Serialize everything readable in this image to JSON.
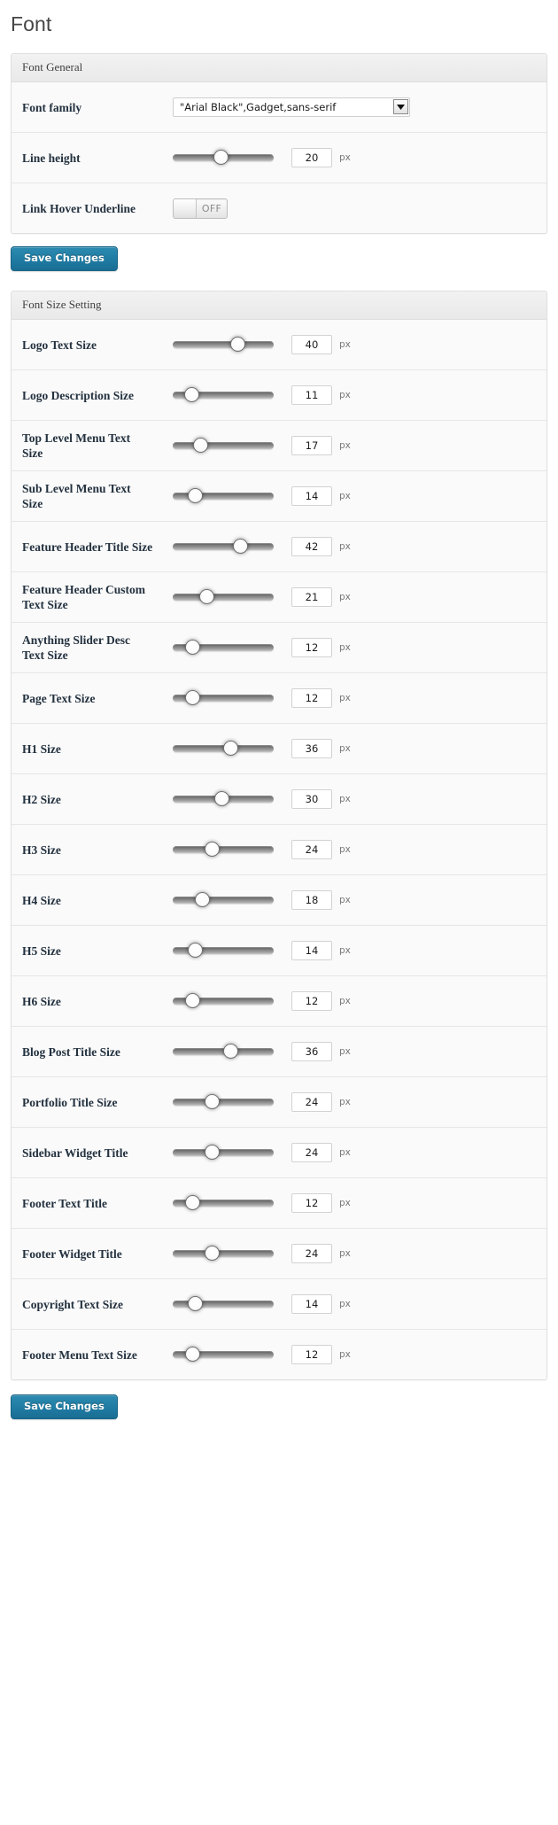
{
  "page": {
    "title": "Font"
  },
  "general_panel": {
    "header": "Font General",
    "rows": [
      {
        "label": "Font family",
        "control": "select",
        "value": "\"Arial Black\",Gadget,sans-serif",
        "icon": "chevron-down-icon"
      },
      {
        "label": "Line height",
        "control": "slider",
        "value": "20",
        "unit": "px",
        "handle_pct": 47
      },
      {
        "label": "Link Hover Underline",
        "control": "toggle",
        "state": "OFF"
      }
    ],
    "save_label": "Save Changes"
  },
  "size_panel": {
    "header": "Font Size Setting",
    "unit": "px",
    "rows": [
      {
        "label": "Logo Text Size",
        "value": "40",
        "handle_pct": 64
      },
      {
        "label": "Logo Description Size",
        "value": "11",
        "handle_pct": 18
      },
      {
        "label": "Top Level Menu Text Size",
        "value": "17",
        "handle_pct": 27
      },
      {
        "label": "Sub Level Menu Text Size",
        "value": "14",
        "handle_pct": 22
      },
      {
        "label": "Feature Header Title Size",
        "value": "42",
        "handle_pct": 67
      },
      {
        "label": "Feature Header Custom Text Size",
        "value": "21",
        "handle_pct": 33
      },
      {
        "label": "Anything Slider Desc Text Size",
        "value": "12",
        "handle_pct": 19
      },
      {
        "label": "Page Text Size",
        "value": "12",
        "handle_pct": 19
      },
      {
        "label": "H1 Size",
        "value": "36",
        "handle_pct": 57
      },
      {
        "label": "H2 Size",
        "value": "30",
        "handle_pct": 48
      },
      {
        "label": "H3 Size",
        "value": "24",
        "handle_pct": 39
      },
      {
        "label": "H4 Size",
        "value": "18",
        "handle_pct": 29
      },
      {
        "label": "H5 Size",
        "value": "14",
        "handle_pct": 22
      },
      {
        "label": "H6 Size",
        "value": "12",
        "handle_pct": 19
      },
      {
        "label": "Blog Post Title Size",
        "value": "36",
        "handle_pct": 57
      },
      {
        "label": "Portfolio Title Size",
        "value": "24",
        "handle_pct": 39
      },
      {
        "label": "Sidebar Widget Title",
        "value": "24",
        "handle_pct": 39
      },
      {
        "label": "Footer Text Title",
        "value": "12",
        "handle_pct": 19
      },
      {
        "label": "Footer Widget Title",
        "value": "24",
        "handle_pct": 39
      },
      {
        "label": "Copyright Text Size",
        "value": "14",
        "handle_pct": 22
      },
      {
        "label": "Footer Menu Text Size",
        "value": "12",
        "handle_pct": 19
      }
    ],
    "save_label": "Save Changes"
  },
  "colors": {
    "accent": "#1f7ba3",
    "panel_border": "#dfdfdf",
    "panel_bg": "#fafafa",
    "label_text": "#23313f"
  }
}
